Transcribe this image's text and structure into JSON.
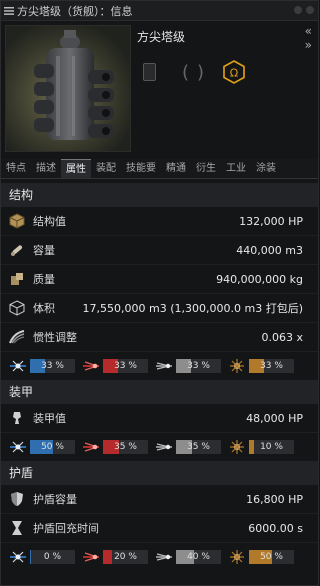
{
  "window": {
    "title": "方尖塔级（货舰）：信息"
  },
  "header": {
    "ship_name": "方尖塔级",
    "collapse_icon": "double-chevron-right"
  },
  "tabs": [
    {
      "label": "特点"
    },
    {
      "label": "描述"
    },
    {
      "label": "属性",
      "active": true
    },
    {
      "label": "装配"
    },
    {
      "label": "技能要"
    },
    {
      "label": "精通"
    },
    {
      "label": "衍生"
    },
    {
      "label": "工业"
    },
    {
      "label": "涂装"
    }
  ],
  "structure": {
    "title": "结构",
    "rows": [
      {
        "icon": "structure-cube-icon",
        "label": "结构值",
        "value": "132,000 HP"
      },
      {
        "icon": "capacity-icon",
        "label": "容量",
        "value": "440,000 m3"
      },
      {
        "icon": "mass-icon",
        "label": "质量",
        "value": "940,000,000 kg"
      },
      {
        "icon": "volume-cube-icon",
        "label": "体积",
        "value": "17,550,000 m3 (1,300,000.0 m3 打包后)"
      },
      {
        "icon": "inertia-icon",
        "label": "惯性调整",
        "value": "0.063 x"
      }
    ],
    "resists": [
      {
        "type": "em",
        "label": "33 %",
        "level": 33
      },
      {
        "type": "thermal",
        "label": "33 %",
        "level": 33
      },
      {
        "type": "kinetic",
        "label": "33 %",
        "level": 33
      },
      {
        "type": "explosive",
        "label": "33 %",
        "level": 33
      }
    ]
  },
  "armor": {
    "title": "装甲",
    "rows": [
      {
        "icon": "armor-icon",
        "label": "装甲值",
        "value": "48,000 HP"
      }
    ],
    "resists": [
      {
        "type": "em",
        "label": "50 %",
        "level": 50
      },
      {
        "type": "thermal",
        "label": "35 %",
        "level": 35
      },
      {
        "type": "kinetic",
        "label": "35 %",
        "level": 35
      },
      {
        "type": "explosive",
        "label": "10 %",
        "level": 10
      }
    ]
  },
  "shield": {
    "title": "护盾",
    "rows": [
      {
        "icon": "shield-icon",
        "label": "护盾容量",
        "value": "16,800 HP"
      },
      {
        "icon": "hourglass-icon",
        "label": "护盾回充时间",
        "value": "6000.00 s"
      }
    ],
    "resists": [
      {
        "type": "em",
        "label": "0 %",
        "level": 0
      },
      {
        "type": "thermal",
        "label": "20 %",
        "level": 20
      },
      {
        "type": "kinetic",
        "label": "40 %",
        "level": 40
      },
      {
        "type": "explosive",
        "label": "50 %",
        "level": 50
      }
    ]
  },
  "colors": {
    "em": "#2f6fb0",
    "thermal": "#b52a2a",
    "kinetic": "#8d8d8d",
    "explosive": "#b07a2a",
    "omega": "#e3a11a"
  }
}
